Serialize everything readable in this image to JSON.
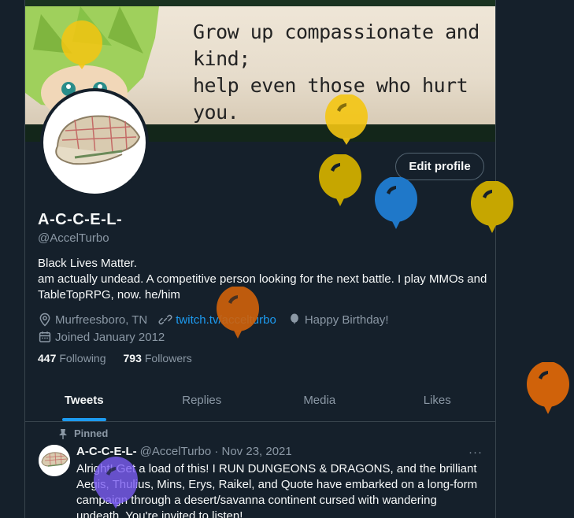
{
  "banner": {
    "quote": "Grow up compassionate and kind;\nhelp even those who hurt you.\nThen, one day...\""
  },
  "profile": {
    "edit_label": "Edit profile",
    "name": "A-C-C-E-L-",
    "handle": "@AccelTurbo",
    "bio_line1": "Black Lives Matter.",
    "bio_line2": "am actually undead. A competitive person looking for the next battle. I play MMOs and TableTopRPG, now. he/him",
    "location": "Murfreesboro, TN",
    "link": "twitch.tv/accelturbo",
    "birthday": "Happy Birthday!",
    "joined": "Joined January 2012",
    "following_count": "447",
    "following_label": "Following",
    "followers_count": "793",
    "followers_label": "Followers"
  },
  "tabs": [
    {
      "label": "Tweets"
    },
    {
      "label": "Replies"
    },
    {
      "label": "Media"
    },
    {
      "label": "Likes"
    }
  ],
  "tweet": {
    "pinned_label": "Pinned",
    "name": "A-C-C-E-L-",
    "meta": "@AccelTurbo · Nov 23, 2021",
    "more": "···",
    "text": "Alright! Get a load of this! I RUN DUNGEONS & DRAGONS, and the brilliant Aegis, Thulius, Mins, Erys, Raikel, and Quote have embarked on a long-form campaign through a desert/savanna continent cursed with wandering undeath. You're invited to listen!"
  },
  "icons": {
    "location": "location-pin-icon",
    "link": "link-icon",
    "birthday": "balloon-icon",
    "calendar": "calendar-icon",
    "pin": "pin-icon"
  },
  "colors": {
    "background": "#15202b",
    "accent": "#1d9bf0",
    "secondary_text": "#8b98a5",
    "balloon_yellow": "#f4c512",
    "balloon_olive": "#c6a600",
    "balloon_blue": "#1f78c9",
    "balloon_orange": "#d0620a",
    "balloon_purple": "#7b5cf2"
  }
}
